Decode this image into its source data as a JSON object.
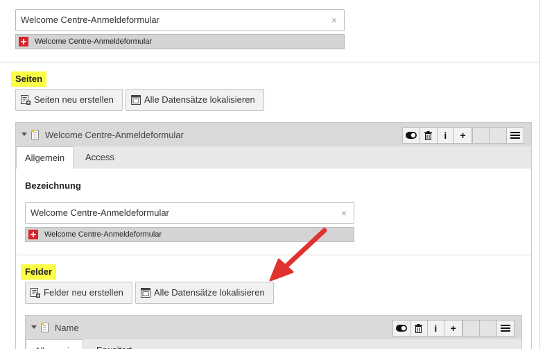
{
  "top": {
    "input_value": "Welcome Centre-Anmeldeformular",
    "clear_symbol": "×",
    "language_label": "Welcome Centre-Anmeldeformular"
  },
  "seiten": {
    "heading": "Seiten",
    "new_button": "Seiten neu erstellen",
    "localize_button": "Alle Datensätze lokalisieren"
  },
  "record": {
    "title": "Welcome Centre-Anmeldeformular",
    "controls": {
      "info": "i",
      "add": "+"
    },
    "tabs": [
      "Allgemein",
      "Access"
    ],
    "field_label": "Bezeichnung",
    "input_value": "Welcome Centre-Anmeldeformular",
    "clear_symbol": "×",
    "language_label": "Welcome Centre-Anmeldeformular"
  },
  "felder": {
    "heading": "Felder",
    "new_button": "Felder neu erstellen",
    "localize_button": "Alle Datensätze lokalisieren"
  },
  "subrecord": {
    "title": "Name",
    "controls": {
      "info": "i",
      "add": "+"
    },
    "tabs": [
      "Allgemein",
      "Erweitert"
    ]
  },
  "colors": {
    "highlight": "#fcff44",
    "flag_red": "#d8232a",
    "arrow_red": "#e0322f",
    "header_gray": "#d9d9d9"
  },
  "icons": [
    "clear-icon",
    "swiss-flag-icon",
    "new-record-icon",
    "localize-icon",
    "collapse-caret-icon",
    "document-icon",
    "toggle-icon",
    "trash-icon",
    "info-icon",
    "plus-icon",
    "menu-icon",
    "arrow-annotation"
  ]
}
